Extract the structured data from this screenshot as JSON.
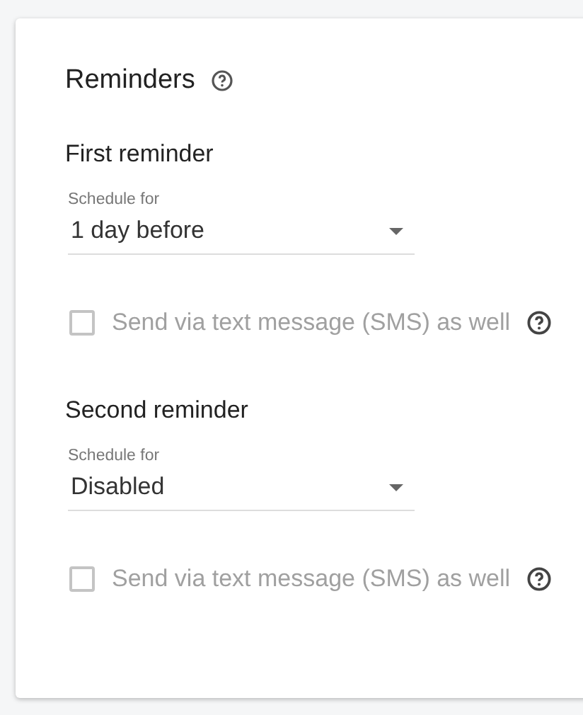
{
  "section": {
    "title": "Reminders"
  },
  "reminders": [
    {
      "title": "First reminder",
      "schedule": {
        "label": "Schedule for",
        "value": "1 day before"
      },
      "sms": {
        "label": "Send via text message (SMS) as well",
        "checked": false,
        "disabled": true
      }
    },
    {
      "title": "Second reminder",
      "schedule": {
        "label": "Schedule for",
        "value": "Disabled"
      },
      "sms": {
        "label": "Send via text message (SMS) as well",
        "checked": false,
        "disabled": true
      }
    }
  ]
}
